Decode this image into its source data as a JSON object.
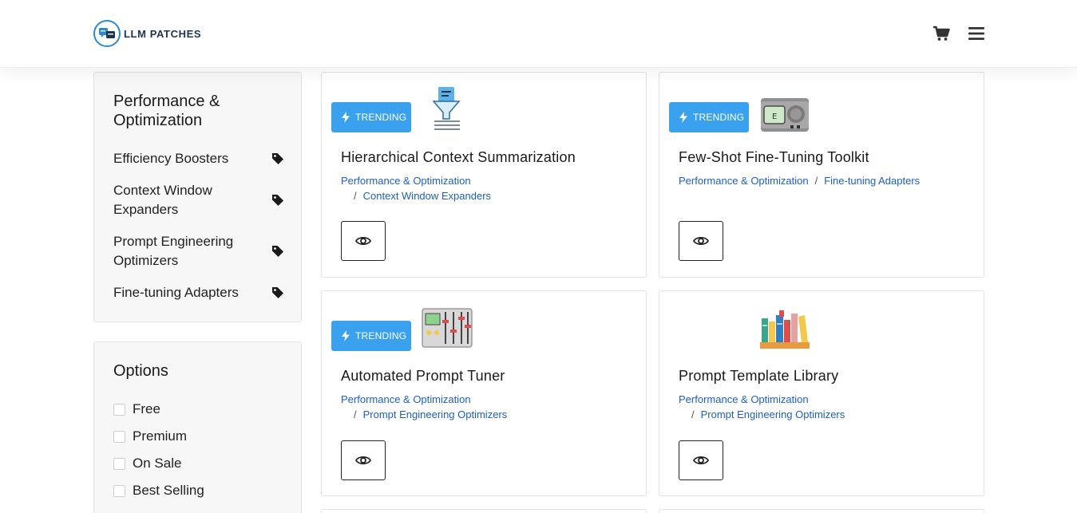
{
  "brand": {
    "name": "LLM PATCHES"
  },
  "header": {
    "cart_icon": "cart-icon",
    "menu_icon": "hamburger-menu-icon"
  },
  "sidebar": {
    "categories": {
      "title": "Performance & Optimization",
      "items": [
        {
          "label": "Efficiency Boosters",
          "icon": "tag-icon"
        },
        {
          "label": "Context Window Expanders",
          "icon": "tag-icon"
        },
        {
          "label": "Prompt Engineering Optimizers",
          "icon": "tag-icon"
        },
        {
          "label": "Fine-tuning Adapters",
          "icon": "tag-icon"
        }
      ]
    },
    "options": {
      "title": "Options",
      "items": [
        {
          "label": "Free"
        },
        {
          "label": "Premium"
        },
        {
          "label": "On Sale"
        },
        {
          "label": "Best Selling"
        }
      ]
    }
  },
  "cards": [
    {
      "badge": "TRENDING",
      "title": "Hierarchical Context Summarization",
      "crumb1": "Performance & Optimization",
      "crumb2": "Context Window Expanders",
      "image": "funnel-document-icon"
    },
    {
      "badge": "TRENDING",
      "title": "Few-Shot Fine-Tuning Toolkit",
      "crumb1": "Performance & Optimization",
      "crumb2": "Fine-tuning Adapters",
      "image": "gauge-device-icon"
    },
    {
      "badge": "TRENDING",
      "title": "Automated Prompt Tuner",
      "crumb1": "Performance & Optimization",
      "crumb2": "Prompt Engineering Optimizers",
      "image": "mixer-panel-icon"
    },
    {
      "badge": "",
      "title": "Prompt Template Library",
      "crumb1": "Performance & Optimization",
      "crumb2": "Prompt Engineering Optimizers",
      "image": "bookshelf-icon"
    }
  ],
  "colors": {
    "accent": "#3aa1ef",
    "link": "#1d5fc4",
    "sidebar_bg": "#f7f7f7"
  }
}
